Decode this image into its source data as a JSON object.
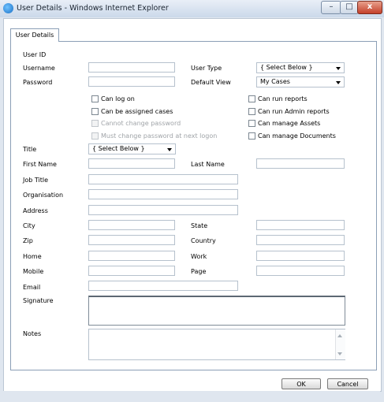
{
  "window": {
    "title": "User Details - Windows Internet Explorer",
    "minimize": "–",
    "maximize": "□",
    "close": "x"
  },
  "tab": {
    "label": "User Details"
  },
  "labels": {
    "user_id": "User ID",
    "username": "Username",
    "password": "Password",
    "user_type": "User Type",
    "default_view": "Default View",
    "title": "Title",
    "first_name": "First Name",
    "last_name": "Last Name",
    "job_title": "Job Title",
    "organisation": "Organisation",
    "address": "Address",
    "city": "City",
    "state": "State",
    "zip": "Zip",
    "country": "Country",
    "home": "Home",
    "work": "Work",
    "mobile": "Mobile",
    "page": "Page",
    "email": "Email",
    "signature": "Signature",
    "notes": "Notes"
  },
  "selects": {
    "user_type": "{ Select Below }",
    "default_view": "My Cases",
    "title": "{ Select Below }"
  },
  "checkboxes": {
    "can_log_on": "Can log on",
    "can_be_assigned": "Can be assigned cases",
    "cannot_change_password": "Cannot change password",
    "must_change_password": "Must change password at next logon",
    "can_run_reports": "Can run reports",
    "can_run_admin_reports": "Can run Admin reports",
    "can_manage_assets": "Can manage Assets",
    "can_manage_documents": "Can manage Documents"
  },
  "buttons": {
    "ok": "OK",
    "cancel": "Cancel"
  }
}
